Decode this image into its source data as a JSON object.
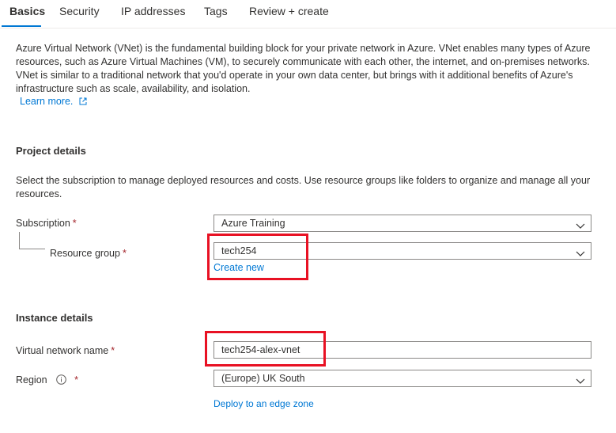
{
  "tabs": [
    {
      "label": "Basics",
      "active": true
    },
    {
      "label": "Security",
      "active": false
    },
    {
      "label": "IP addresses",
      "active": false
    },
    {
      "label": "Tags",
      "active": false
    },
    {
      "label": "Review + create",
      "active": false
    }
  ],
  "intro": {
    "text": "Azure Virtual Network (VNet) is the fundamental building block for your private network in Azure. VNet enables many types of Azure resources, such as Azure Virtual Machines (VM), to securely communicate with each other, the internet, and on-premises networks. VNet is similar to a traditional network that you'd operate in your own data center, but brings with it additional benefits of Azure's infrastructure such as scale, availability, and isolation.",
    "learn_more": "Learn more."
  },
  "project_details": {
    "title": "Project details",
    "description": "Select the subscription to manage deployed resources and costs. Use resource groups like folders to organize and manage all your resources.",
    "subscription_label": "Subscription",
    "subscription_value": "Azure Training",
    "resource_group_label": "Resource group",
    "resource_group_value": "tech254",
    "create_new": "Create new"
  },
  "instance_details": {
    "title": "Instance details",
    "vnet_name_label": "Virtual network name",
    "vnet_name_value": "tech254-alex-vnet",
    "region_label": "Region",
    "region_value": "(Europe) UK South",
    "edge_zone_link": "Deploy to an edge zone"
  },
  "required_marker": "*",
  "colors": {
    "link": "#0078d4",
    "required": "#a4262c",
    "highlight": "#e81123",
    "border": "#8a8886"
  }
}
